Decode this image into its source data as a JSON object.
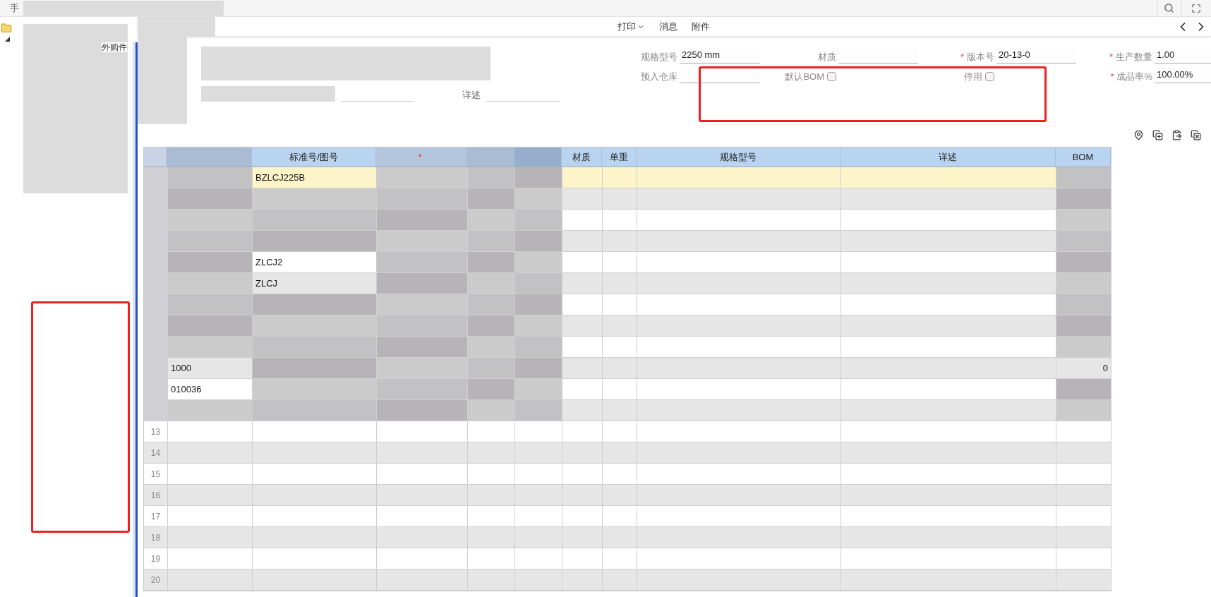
{
  "top_bar": {
    "tab_fragment": "手"
  },
  "tree": {
    "items": [
      {
        "label": "外购件",
        "expanded": true
      }
    ]
  },
  "toolbar": {
    "buttons": [
      {
        "label": "打印",
        "has_menu": true
      },
      {
        "label": "消息",
        "has_menu": false
      },
      {
        "label": "附件",
        "has_menu": false
      }
    ]
  },
  "form": {
    "detail_label": "详述",
    "rows": [
      [
        {
          "kind": "text",
          "label": "规格型号",
          "value": "2250 mm"
        },
        {
          "kind": "text",
          "label": "材质"
        },
        {
          "kind": "text",
          "label": "版本号",
          "mark": "*",
          "value": "20-13-0"
        },
        {
          "kind": "text",
          "label": "生产数量",
          "mark": "*",
          "value": "1.00"
        }
      ],
      [
        {
          "kind": "text",
          "label": "预入仓库"
        },
        {
          "kind": "checkbox",
          "label": "默认BOM",
          "checked": false
        },
        {
          "kind": "checkbox",
          "label": "停用",
          "checked": false
        },
        {
          "kind": "text",
          "label": "成品率%",
          "mark": "*",
          "value": "100.00%"
        }
      ]
    ]
  },
  "table": {
    "columns": [
      {
        "redacted": true
      },
      {
        "label": "标准号/图号",
        "redacted": false
      },
      {
        "redacted": true,
        "mark": "*"
      },
      {
        "redacted": true
      },
      {
        "redacted": true
      },
      {
        "label": "材质",
        "redacted": false
      },
      {
        "label": "单重",
        "redacted": false
      },
      {
        "label": "规格型号",
        "redacted": false
      },
      {
        "label": "详述",
        "redacted": false
      },
      {
        "label": "BOM",
        "redacted": false
      }
    ],
    "rows": [
      {
        "selected": true,
        "cells": [
          {
            "redacted": true
          },
          {
            "text": "BZLCJ225B",
            "redacted": false
          },
          {
            "redacted": true
          },
          {
            "redacted": true
          },
          {
            "redacted": true
          },
          {
            "redacted": false
          },
          {
            "redacted": false
          },
          {
            "redacted": false
          },
          {
            "redacted": false
          },
          {
            "redacted": true
          }
        ]
      },
      {
        "selected": false,
        "cells": [
          {
            "redacted": true
          },
          {
            "redacted": true
          },
          {
            "redacted": true
          },
          {
            "redacted": true
          },
          {
            "redacted": true
          },
          {
            "redacted": false
          },
          {
            "redacted": false
          },
          {
            "redacted": false
          },
          {
            "redacted": false
          },
          {
            "redacted": true
          }
        ]
      },
      {
        "selected": false,
        "cells": [
          {
            "redacted": true
          },
          {
            "redacted": true
          },
          {
            "redacted": true
          },
          {
            "redacted": true
          },
          {
            "redacted": true
          },
          {
            "redacted": false
          },
          {
            "redacted": false
          },
          {
            "redacted": false
          },
          {
            "redacted": false
          },
          {
            "redacted": true
          }
        ]
      },
      {
        "selected": false,
        "cells": [
          {
            "redacted": true
          },
          {
            "redacted": true
          },
          {
            "redacted": true
          },
          {
            "redacted": true
          },
          {
            "redacted": true
          },
          {
            "redacted": false
          },
          {
            "redacted": false
          },
          {
            "redacted": false
          },
          {
            "redacted": false
          },
          {
            "redacted": true
          }
        ]
      },
      {
        "selected": false,
        "cells": [
          {
            "redacted": true
          },
          {
            "text": "ZLCJ2",
            "redacted": false
          },
          {
            "redacted": true
          },
          {
            "redacted": true
          },
          {
            "redacted": true
          },
          {
            "redacted": false
          },
          {
            "redacted": false
          },
          {
            "redacted": false
          },
          {
            "redacted": false
          },
          {
            "redacted": true
          }
        ]
      },
      {
        "selected": false,
        "cells": [
          {
            "redacted": true
          },
          {
            "text": "ZLCJ",
            "redacted": false
          },
          {
            "redacted": true
          },
          {
            "redacted": true
          },
          {
            "redacted": true
          },
          {
            "redacted": false
          },
          {
            "redacted": false
          },
          {
            "redacted": false
          },
          {
            "redacted": false
          },
          {
            "redacted": true
          }
        ]
      },
      {
        "selected": false,
        "cells": [
          {
            "redacted": true
          },
          {
            "redacted": true
          },
          {
            "redacted": true
          },
          {
            "redacted": true
          },
          {
            "redacted": true
          },
          {
            "redacted": false
          },
          {
            "redacted": false
          },
          {
            "redacted": false
          },
          {
            "redacted": false
          },
          {
            "redacted": true
          }
        ]
      },
      {
        "selected": false,
        "cells": [
          {
            "redacted": true
          },
          {
            "redacted": true
          },
          {
            "redacted": true
          },
          {
            "redacted": true
          },
          {
            "redacted": true
          },
          {
            "redacted": false
          },
          {
            "redacted": false
          },
          {
            "redacted": false
          },
          {
            "redacted": false
          },
          {
            "redacted": true
          }
        ]
      },
      {
        "selected": false,
        "cells": [
          {
            "redacted": true
          },
          {
            "redacted": true
          },
          {
            "redacted": true
          },
          {
            "redacted": true
          },
          {
            "redacted": true
          },
          {
            "redacted": false
          },
          {
            "redacted": false
          },
          {
            "redacted": false
          },
          {
            "redacted": false
          },
          {
            "redacted": true
          }
        ]
      },
      {
        "selected": false,
        "cells": [
          {
            "text": "1000",
            "redacted": false
          },
          {
            "redacted": true
          },
          {
            "redacted": true
          },
          {
            "redacted": true
          },
          {
            "redacted": true
          },
          {
            "redacted": false
          },
          {
            "redacted": false
          },
          {
            "redacted": false
          },
          {
            "redacted": false
          },
          {
            "text": "0",
            "redacted": false
          }
        ]
      },
      {
        "selected": false,
        "cells": [
          {
            "text": "010036",
            "redacted": false
          },
          {
            "redacted": true
          },
          {
            "redacted": true
          },
          {
            "redacted": true
          },
          {
            "redacted": true
          },
          {
            "redacted": false
          },
          {
            "redacted": false
          },
          {
            "redacted": false
          },
          {
            "redacted": false
          },
          {
            "redacted": true
          }
        ]
      },
      {
        "selected": false,
        "cells": [
          {
            "redacted": true
          },
          {
            "redacted": true
          },
          {
            "redacted": true
          },
          {
            "redacted": true
          },
          {
            "redacted": true
          },
          {
            "redacted": false
          },
          {
            "redacted": false
          },
          {
            "redacted": false
          },
          {
            "redacted": false
          },
          {
            "redacted": true
          }
        ]
      },
      {
        "number": "13",
        "selected": false,
        "cells": [
          {
            "redacted": false
          },
          {
            "redacted": false
          },
          {
            "redacted": false
          },
          {
            "redacted": false
          },
          {
            "redacted": false
          },
          {
            "redacted": false
          },
          {
            "redacted": false
          },
          {
            "redacted": false
          },
          {
            "redacted": false
          },
          {
            "redacted": false
          }
        ]
      },
      {
        "number": "14",
        "selected": false,
        "cells": [
          {
            "redacted": false
          },
          {
            "redacted": false
          },
          {
            "redacted": false
          },
          {
            "redacted": false
          },
          {
            "redacted": false
          },
          {
            "redacted": false
          },
          {
            "redacted": false
          },
          {
            "redacted": false
          },
          {
            "redacted": false
          },
          {
            "redacted": false
          }
        ]
      },
      {
        "number": "15",
        "selected": false,
        "cells": [
          {
            "redacted": false
          },
          {
            "redacted": false
          },
          {
            "redacted": false
          },
          {
            "redacted": false
          },
          {
            "redacted": false
          },
          {
            "redacted": false
          },
          {
            "redacted": false
          },
          {
            "redacted": false
          },
          {
            "redacted": false
          },
          {
            "redacted": false
          }
        ]
      },
      {
        "number": "16",
        "selected": false,
        "cells": [
          {
            "redacted": false
          },
          {
            "redacted": false
          },
          {
            "redacted": false
          },
          {
            "redacted": false
          },
          {
            "redacted": false
          },
          {
            "redacted": false
          },
          {
            "redacted": false
          },
          {
            "redacted": false
          },
          {
            "redacted": false
          },
          {
            "redacted": false
          }
        ]
      },
      {
        "number": "17",
        "selected": false,
        "cells": [
          {
            "redacted": false
          },
          {
            "redacted": false
          },
          {
            "redacted": false
          },
          {
            "redacted": false
          },
          {
            "redacted": false
          },
          {
            "redacted": false
          },
          {
            "redacted": false
          },
          {
            "redacted": false
          },
          {
            "redacted": false
          },
          {
            "redacted": false
          }
        ]
      },
      {
        "number": "18",
        "selected": false,
        "cells": [
          {
            "redacted": false
          },
          {
            "redacted": false
          },
          {
            "redacted": false
          },
          {
            "redacted": false
          },
          {
            "redacted": false
          },
          {
            "redacted": false
          },
          {
            "redacted": false
          },
          {
            "redacted": false
          },
          {
            "redacted": false
          },
          {
            "redacted": false
          }
        ]
      },
      {
        "number": "19",
        "selected": false,
        "cells": [
          {
            "redacted": false
          },
          {
            "redacted": false
          },
          {
            "redacted": false
          },
          {
            "redacted": false
          },
          {
            "redacted": false
          },
          {
            "redacted": false
          },
          {
            "redacted": false
          },
          {
            "redacted": false
          },
          {
            "redacted": false
          },
          {
            "redacted": false
          }
        ]
      },
      {
        "number": "20",
        "selected": false,
        "cells": [
          {
            "redacted": false
          },
          {
            "redacted": false
          },
          {
            "redacted": false
          },
          {
            "redacted": false
          },
          {
            "redacted": false
          },
          {
            "redacted": false
          },
          {
            "redacted": false
          },
          {
            "redacted": false
          },
          {
            "redacted": false
          },
          {
            "redacted": false
          }
        ]
      }
    ]
  }
}
